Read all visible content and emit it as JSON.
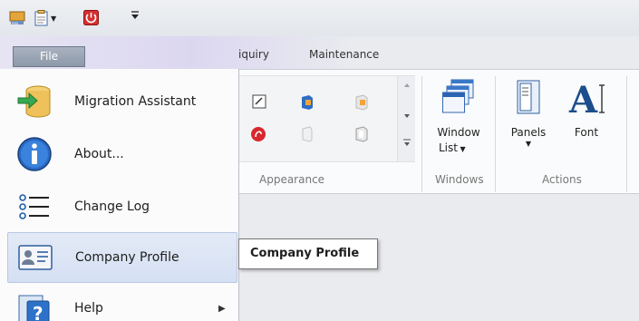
{
  "quick_access": {
    "items": [
      {
        "name": "app-icon"
      },
      {
        "name": "clipboard-icon",
        "has_dropdown": true
      },
      {
        "name": "power-icon"
      },
      {
        "name": "customize-qat-icon"
      }
    ]
  },
  "tabs": {
    "file": "File",
    "inquiry_partial": "iquiry",
    "maintenance": "Maintenance"
  },
  "ribbon": {
    "groups": {
      "appearance": "Appearance",
      "windows": "Windows",
      "actions": "Actions"
    },
    "buttons": {
      "window_list_line1": "Window",
      "window_list_line2": "List",
      "panels": "Panels",
      "font": "Font"
    }
  },
  "file_menu": {
    "items": [
      {
        "label": "Migration Assistant",
        "icon": "database-arrow-icon"
      },
      {
        "label": "About...",
        "icon": "info-icon"
      },
      {
        "label": "Change Log",
        "icon": "list-icon"
      },
      {
        "label": "Company Profile",
        "icon": "id-card-icon",
        "highlighted": true
      },
      {
        "label": "Help",
        "icon": "help-icon",
        "has_submenu": true
      }
    ]
  },
  "tooltip": {
    "text": "Company Profile"
  },
  "colors": {
    "file_tab": "#8e99a9",
    "hover": "#d5e0f3",
    "accent_blue": "#1f5fa8"
  }
}
